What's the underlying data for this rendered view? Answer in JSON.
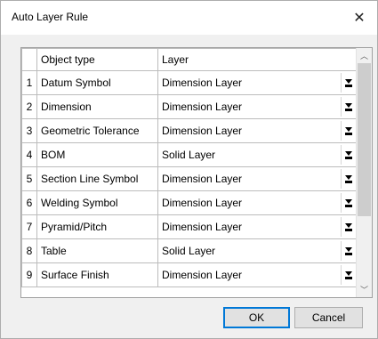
{
  "window": {
    "title": "Auto Layer Rule"
  },
  "grid": {
    "headers": {
      "num": "",
      "object_type": "Object type",
      "layer": "Layer"
    },
    "rows": [
      {
        "num": "1",
        "object_type": "Datum Symbol",
        "layer": "Dimension Layer"
      },
      {
        "num": "2",
        "object_type": "Dimension",
        "layer": "Dimension Layer"
      },
      {
        "num": "3",
        "object_type": "Geometric Tolerance",
        "layer": "Dimension Layer"
      },
      {
        "num": "4",
        "object_type": "BOM",
        "layer": "Solid Layer"
      },
      {
        "num": "5",
        "object_type": "Section Line Symbol",
        "layer": "Dimension Layer"
      },
      {
        "num": "6",
        "object_type": "Welding Symbol",
        "layer": "Dimension Layer"
      },
      {
        "num": "7",
        "object_type": "Pyramid/Pitch",
        "layer": "Dimension Layer"
      },
      {
        "num": "8",
        "object_type": "Table",
        "layer": "Solid Layer"
      },
      {
        "num": "9",
        "object_type": "Surface Finish",
        "layer": "Dimension Layer"
      }
    ]
  },
  "scrollbar": {
    "up_icon": "chevron-up-icon",
    "down_icon": "chevron-down-icon",
    "position_fraction": 0.0,
    "visible_fraction": 0.7
  },
  "buttons": {
    "ok": "OK",
    "cancel": "Cancel"
  }
}
